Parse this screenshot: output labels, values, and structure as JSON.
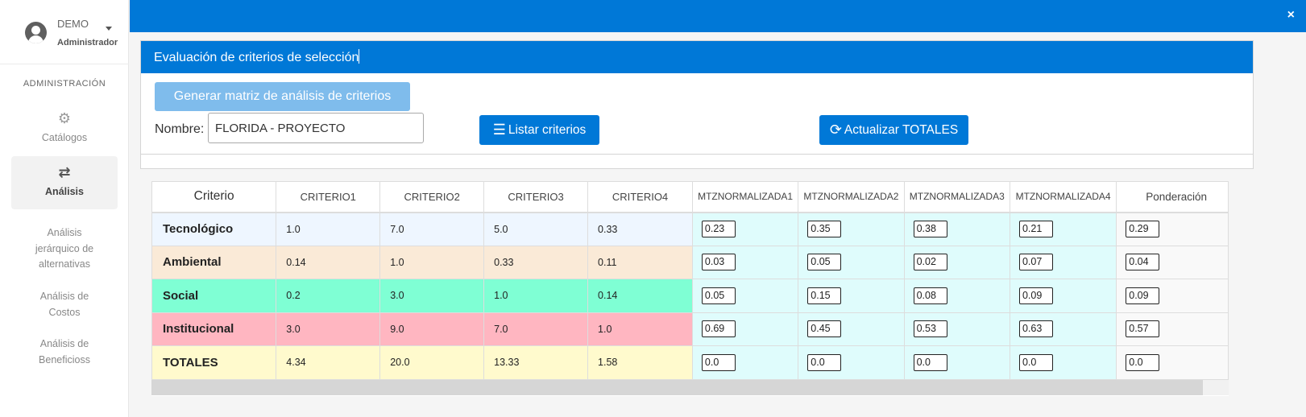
{
  "user": {
    "name": "DEMO",
    "role": "Administrador"
  },
  "sidebar": {
    "section_title": "ADMINISTRACIÓN",
    "catalogos_label": "Catálogos",
    "analisis_label": "Análisis",
    "sub_items": [
      {
        "label": "Análisis jerárquico de alternativas",
        "lines": [
          "Análisis",
          "jerárquico de",
          "alternativas"
        ]
      },
      {
        "label": "Análisis de Costos",
        "lines": [
          "Análisis de",
          "Costos"
        ]
      },
      {
        "label": "Análisis de Beneficioss",
        "lines": [
          "Análisis de",
          "Beneficioss"
        ]
      }
    ]
  },
  "topbar": {
    "close_icon": "×"
  },
  "panel": {
    "title": "Evaluación de criterios de selección",
    "generate_button": "Generar matriz de análisis de criterios",
    "name_label": "Nombre:",
    "name_value": "FLORIDA - PROYECTO",
    "list_button": "Listar criterios",
    "update_button": "Actualizar TOTALES"
  },
  "table": {
    "headers": [
      "Criterio",
      "CRITERIO1",
      "CRITERIO2",
      "CRITERIO3",
      "CRITERIO4",
      "MTZNORMALIZADA1",
      "MTZNORMALIZADA2",
      "MTZNORMALIZADA3",
      "MTZNORMALIZADA4",
      "Ponderación"
    ],
    "rows": [
      {
        "name": "Tecnológico",
        "color": "#eef6ff",
        "criterios": [
          "1.0",
          "7.0",
          "5.0",
          "0.33"
        ],
        "normalizada": [
          "0.23",
          "0.35",
          "0.38",
          "0.21"
        ],
        "ponderacion": "0.29"
      },
      {
        "name": "Ambiental",
        "color": "#faead7",
        "criterios": [
          "0.14",
          "1.0",
          "0.33",
          "0.11"
        ],
        "normalizada": [
          "0.03",
          "0.05",
          "0.02",
          "0.07"
        ],
        "ponderacion": "0.04"
      },
      {
        "name": "Social",
        "color": "#7fffd4",
        "criterios": [
          "0.2",
          "3.0",
          "1.0",
          "0.14"
        ],
        "normalizada": [
          "0.05",
          "0.15",
          "0.08",
          "0.09"
        ],
        "ponderacion": "0.09"
      },
      {
        "name": "Institucional",
        "color": "#ffb6c1",
        "criterios": [
          "3.0",
          "9.0",
          "7.0",
          "1.0"
        ],
        "normalizada": [
          "0.69",
          "0.45",
          "0.53",
          "0.63"
        ],
        "ponderacion": "0.57"
      },
      {
        "name": "TOTALES",
        "color": "#fffacd",
        "criterios": [
          "4.34",
          "20.0",
          "13.33",
          "1.58"
        ],
        "normalizada": [
          "0.0",
          "0.0",
          "0.0",
          "0.0"
        ],
        "ponderacion": "0.0"
      }
    ]
  }
}
